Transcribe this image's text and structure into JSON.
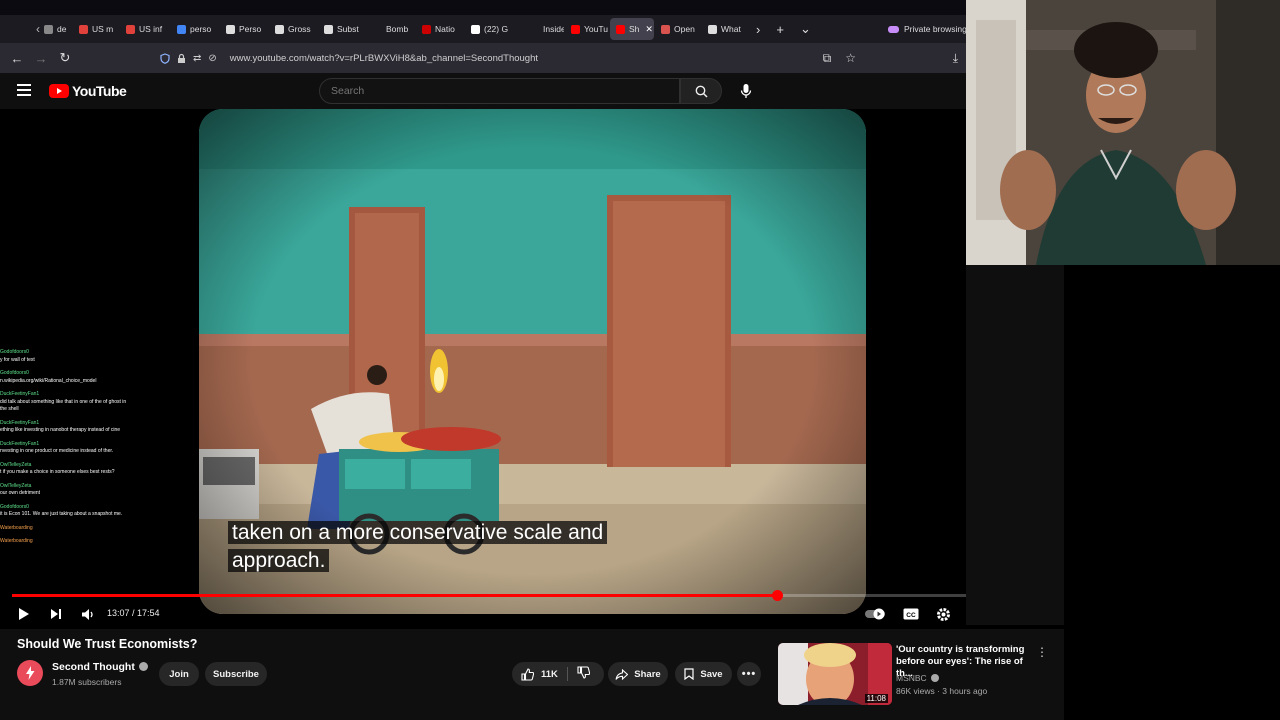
{
  "browser": {
    "tabs": [
      {
        "label": "de",
        "color": "#888888"
      },
      {
        "label": "US m",
        "color": "#e0423b"
      },
      {
        "label": "US inf",
        "color": "#e0423b"
      },
      {
        "label": "perso",
        "color": "#4285f4"
      },
      {
        "label": "Perso",
        "color": "#dddddd"
      },
      {
        "label": "Gross",
        "color": "#dddddd"
      },
      {
        "label": "Subst",
        "color": "#dddddd"
      },
      {
        "label": "Bomb",
        "color": "#1c1b22"
      },
      {
        "label": "Natio",
        "color": "#cc0000"
      },
      {
        "label": "(22) G",
        "color": "#ffffff"
      },
      {
        "label": "Inside",
        "color": "#1c1b22"
      },
      {
        "label": "YouTu",
        "color": "#ff0000"
      },
      {
        "label": "Sh",
        "color": "#ff0000",
        "active": true
      },
      {
        "label": "Open",
        "color": "#d9534f"
      },
      {
        "label": "What",
        "color": "#dddddd"
      }
    ],
    "private_label": "Private browsing",
    "url": "www.youtube.com/watch?v=rPLrBWXViH8&ab_channel=SecondThought"
  },
  "youtube": {
    "logo_text": "YouTube",
    "search_placeholder": "Search"
  },
  "player": {
    "caption_line1": "taken on a more conservative scale and",
    "caption_line2": "approach.",
    "time_current": "13:07",
    "time_total": "17:54",
    "time_display": "13:07 / 17:54",
    "progress_fraction": 0.733
  },
  "chat": [
    {
      "user": "Godofdoors0",
      "msg": "y for wall of text"
    },
    {
      "user": "Godofdoors0",
      "msg": "n.wikipedia.org/wiki/Rational_choice_model"
    },
    {
      "user": "DuckFeetinyFan1",
      "msg": "did talk about something like that in one of the of ghost in the shell"
    },
    {
      "user": "DuckFeetinyFan1",
      "msg": "ething like investing in nanobot therapy instead of cine"
    },
    {
      "user": "DuckFeetinyFan1",
      "msg": "nvesting in one product or medicine instead of ther."
    },
    {
      "user": "OwlTelleyZeta",
      "msg": "t if you make a choice in someone elses best rests?"
    },
    {
      "user": "OwlTelleyZeta",
      "msg": "our own detriment"
    },
    {
      "user": "Godofdoors0",
      "msg": "it is Econ 101. We are just taking about a snapshot me."
    },
    {
      "user": "Waterboarding",
      "msg": ""
    },
    {
      "user": "Waterboarding",
      "msg": ""
    }
  ],
  "video": {
    "title": "Should We Trust Economists?",
    "channel": "Second Thought",
    "subscribers": "1.87M subscribers",
    "join_label": "Join",
    "subscribe_label": "Subscribe",
    "likes": "11K",
    "share_label": "Share",
    "save_label": "Save"
  },
  "recommendation": {
    "title": "'Our country is transforming before our eyes': The rise of th...",
    "channel": "MSNBC",
    "meta": "86K views · 3 hours ago",
    "duration": "11:08"
  },
  "colors": {
    "accent_red": "#ff0000",
    "brand_badge": "#e94b5a"
  }
}
